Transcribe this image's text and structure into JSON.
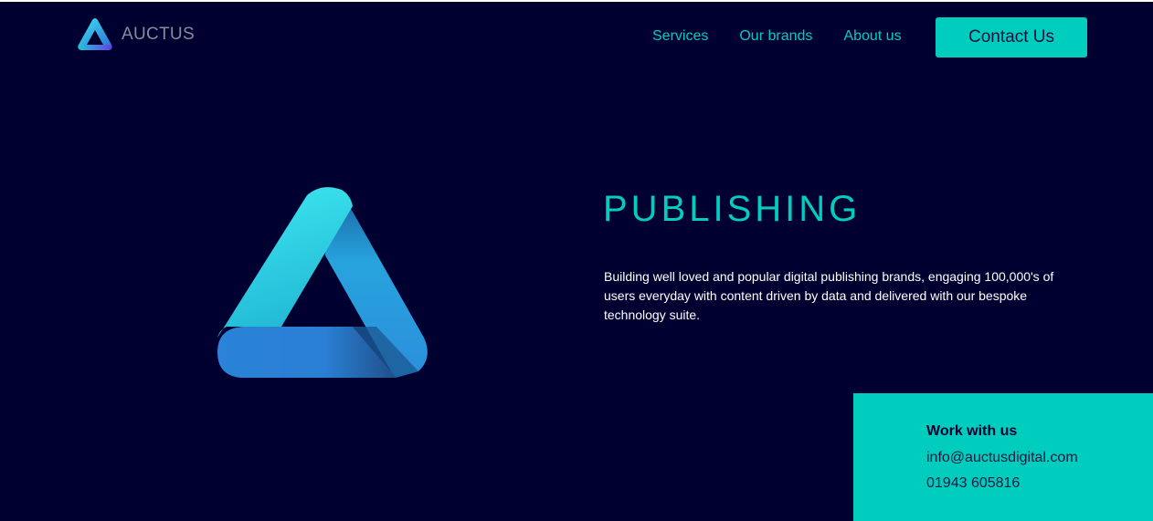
{
  "header": {
    "logo_text": "AUCTUS",
    "nav": [
      "Services",
      "Our brands",
      "About us"
    ],
    "contact_label": "Contact Us"
  },
  "hero": {
    "title": "PUBLISHING",
    "description": "Building well loved and popular digital publishing brands, engaging 100,000's of users everyday with content driven by data and delivered with our bespoke technology suite."
  },
  "work": {
    "heading": "Work with us",
    "email": "info@auctusdigital.com",
    "phone": "01943 605816"
  },
  "colors": {
    "background": "#000030",
    "accent": "#00cdbd",
    "text_light": "#ffffff"
  },
  "icons": [
    "auctus-logo-icon",
    "triangle-logo-icon"
  ]
}
